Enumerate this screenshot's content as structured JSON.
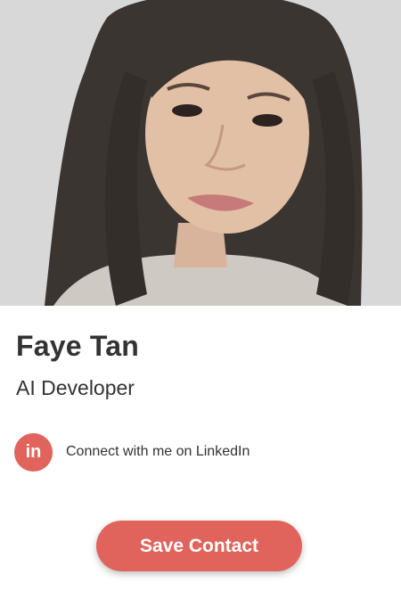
{
  "profile": {
    "name": "Faye Tan",
    "title": "AI Developer"
  },
  "linkedin": {
    "icon": "linkedin-icon",
    "icon_text": "in",
    "label": "Connect with me on LinkedIn"
  },
  "actions": {
    "save_label": "Save Contact"
  },
  "colors": {
    "accent": "#e0645c",
    "text": "#333333",
    "photo_background": "#d9d9d9"
  }
}
